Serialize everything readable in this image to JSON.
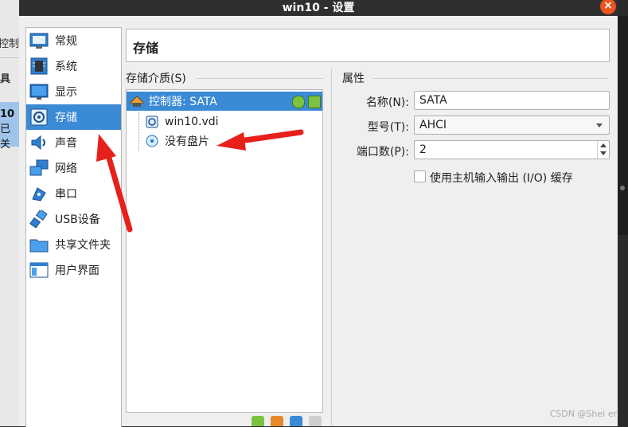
{
  "window": {
    "title": "win10 - 设置",
    "close_glyph": "×"
  },
  "background_app": {
    "text1": "控制台",
    "text2": "具",
    "selected_line1": "10",
    "selected_line2": "已关"
  },
  "categories": [
    {
      "label": "常规",
      "icon": "general-icon"
    },
    {
      "label": "系统",
      "icon": "system-icon"
    },
    {
      "label": "显示",
      "icon": "display-icon"
    },
    {
      "label": "存储",
      "icon": "storage-icon",
      "selected": true
    },
    {
      "label": "声音",
      "icon": "audio-icon"
    },
    {
      "label": "网络",
      "icon": "network-icon"
    },
    {
      "label": "串口",
      "icon": "serial-port-icon"
    },
    {
      "label": "USB设备",
      "icon": "usb-icon"
    },
    {
      "label": "共享文件夹",
      "icon": "shared-folder-icon"
    },
    {
      "label": "用户界面",
      "icon": "user-interface-icon"
    }
  ],
  "page": {
    "title": "存储"
  },
  "storage_media": {
    "label": "存储介质(S)",
    "tree": [
      {
        "label": "控制器: SATA",
        "type": "controller",
        "selected": true
      },
      {
        "label": "win10.vdi",
        "type": "hard-disk"
      },
      {
        "label": "没有盘片",
        "type": "optical-empty"
      }
    ]
  },
  "attributes": {
    "label": "属性",
    "name_label": "名称(N):",
    "name_value": "SATA",
    "type_label": "型号(T):",
    "type_value": "AHCI",
    "port_label": "端口数(P):",
    "port_value": "2",
    "host_io_label": "使用主机输入输出 (I/O) 缓存",
    "host_io_checked": false
  },
  "watermark": "CSDN @Shei er",
  "colors": {
    "selection": "#3a8ad6",
    "title_bar": "#2f2f2f",
    "close_button": "#e95420",
    "annotation_arrow": "#e8201c"
  }
}
